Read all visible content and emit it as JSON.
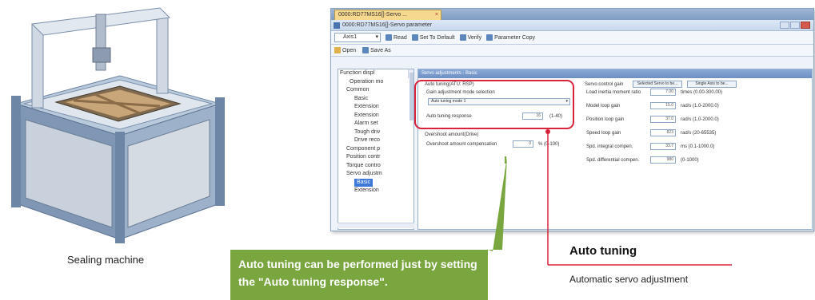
{
  "illustration": {
    "caption": "Sealing machine"
  },
  "window": {
    "tab_title": "0000:RD77MS16[]-Servo ...",
    "title": "0000:RD77MS16[]-Servo parameter",
    "axis_select": "Axis1",
    "toolbar": {
      "read": "Read",
      "set_default": "Set To Default",
      "verify": "Verify",
      "parameter_copy": "Parameter Copy",
      "open": "Open",
      "save_as": "Save As"
    },
    "tree_items": [
      "Function displ",
      "Operation mo",
      "Common",
      "Basic",
      "Extension",
      "Extension",
      "Alarm set",
      "Tough driv",
      "Drive reco",
      "Component p",
      "Position contr",
      "Torque contro",
      "Servo adjustm",
      "Basic",
      "Extension"
    ],
    "panel": {
      "header": "Servo adjustments - Basic",
      "btn_servo": "Selected Servo to be...",
      "btn_axis": "Single Axis to be...",
      "auto_tuning_label": "Auto tuning(ATU: RSP)",
      "gain_mode_label": "Gain adjustment mode selection",
      "gain_mode_value": "Auto tuning mode 1",
      "response_label": "Auto tuning response",
      "response_value": "16",
      "response_range": "(1-40)",
      "overshoot_label": "Overshoot amount(Drive)",
      "overshoot_comp_label": "Overshoot amount compensation",
      "overshoot_value": "0",
      "overshoot_unit": "% (0-100)",
      "gain_title": "Servo control gain",
      "gains": [
        {
          "label": "Load inertia moment ratio",
          "value": "7.00",
          "unit": "times (0.00-300.00)"
        },
        {
          "label": "Model loop gain",
          "value": "15.0",
          "unit": "rad/s (1.0-2000.0)"
        },
        {
          "label": "Position loop gain",
          "value": "37.0",
          "unit": "rad/s (1.0-2000.0)"
        },
        {
          "label": "Speed loop gain",
          "value": "823",
          "unit": "rad/s (20-65535)"
        },
        {
          "label": "Spd. integral compen.",
          "value": "33.7",
          "unit": "ms (0.1-1000.0)"
        },
        {
          "label": "Spd. differential compen.",
          "value": "980",
          "unit": "(0-1000)"
        }
      ]
    }
  },
  "callout_green": "Auto tuning can be performed just by setting the \"Auto tuning response\".",
  "callout_auto": {
    "title": "Auto tuning",
    "subtitle": "Automatic servo adjustment"
  },
  "colors": {
    "green": "#7aa63f",
    "red": "#d9233a",
    "machine_blue": "#9fb8d3"
  }
}
